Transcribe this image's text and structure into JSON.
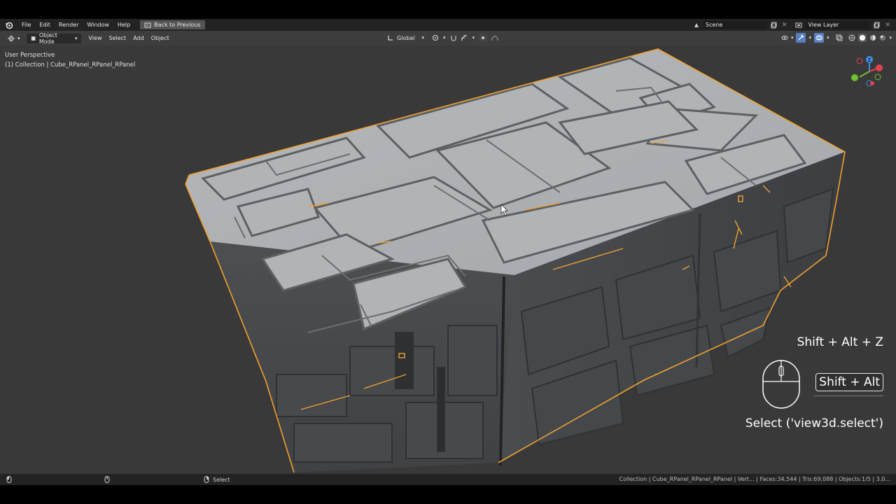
{
  "topbar": {
    "menu": [
      "File",
      "Edit",
      "Render",
      "Window",
      "Help"
    ],
    "back_button": "Back to Previous",
    "scene": "Scene",
    "view_layer": "View Layer"
  },
  "viewport_header": {
    "mode": "Object Mode",
    "menus": [
      "View",
      "Select",
      "Add",
      "Object"
    ],
    "orientation": "Global"
  },
  "viewport": {
    "perspective": "User Perspective",
    "collection_info": "(1) Collection | Cube_RPanel_RPanel_RPanel"
  },
  "keys_overlay": {
    "combo": "Shift + Alt + Z",
    "held_keys": "Shift + Alt",
    "operator": "Select ('view3d.select')"
  },
  "statusbar": {
    "action": "Select",
    "stats": "Collection | Cube_RPanel_RPanel_RPanel | Vert... | Faces:34,544 | Tris:69,088 | Objects:1/5 | 3.0..."
  },
  "colors": {
    "selection_outline": "#f0a030",
    "viewport_bg": "#393939",
    "gizmo_x": "#e0434f",
    "gizmo_y": "#6fbf2f",
    "gizmo_z": "#3f8fe5"
  }
}
